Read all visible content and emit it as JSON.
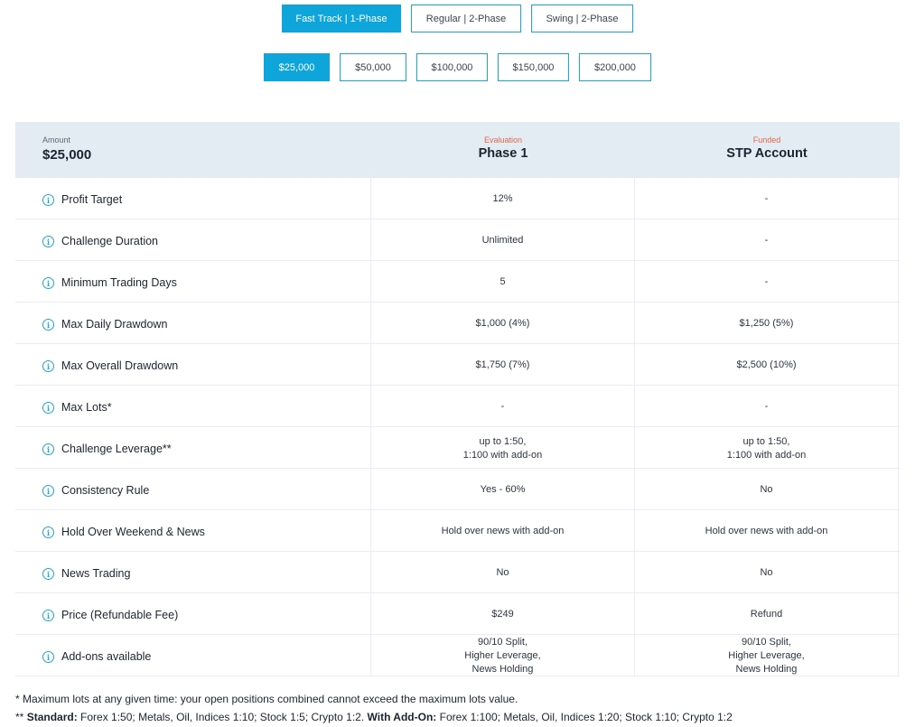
{
  "program_tabs": [
    {
      "label": "Fast Track | 1-Phase",
      "active": true
    },
    {
      "label": "Regular | 2-Phase",
      "active": false
    },
    {
      "label": "Swing | 2-Phase",
      "active": false
    }
  ],
  "amount_tabs": [
    {
      "label": "$25,000",
      "active": true
    },
    {
      "label": "$50,000",
      "active": false
    },
    {
      "label": "$100,000",
      "active": false
    },
    {
      "label": "$150,000",
      "active": false
    },
    {
      "label": "$200,000",
      "active": false
    }
  ],
  "header": {
    "amount_caption": "Amount",
    "amount_value": "$25,000",
    "col1_caption": "Evaluation",
    "col1_title": "Phase 1",
    "col2_caption": "Funded",
    "col2_title": "STP Account"
  },
  "info_icon": "info-circle-icon",
  "rows": [
    {
      "label": "Profit Target",
      "phase1": "12%",
      "stp": "-"
    },
    {
      "label": "Challenge Duration",
      "phase1": "Unlimited",
      "stp": "-"
    },
    {
      "label": "Minimum Trading Days",
      "phase1": "5",
      "stp": "-"
    },
    {
      "label": "Max Daily Drawdown",
      "phase1": "$1,000 (4%)",
      "stp": "$1,250 (5%)"
    },
    {
      "label": "Max Overall Drawdown",
      "phase1": "$1,750 (7%)",
      "stp": "$2,500 (10%)"
    },
    {
      "label": "Max Lots*",
      "phase1": "-",
      "stp": "-"
    },
    {
      "label": "Challenge Leverage**",
      "phase1": "up to 1:50,\n1:100 with add-on",
      "stp": "up to 1:50,\n1:100 with add-on"
    },
    {
      "label": "Consistency Rule",
      "phase1": "Yes - 60%",
      "stp": "No"
    },
    {
      "label": "Hold Over Weekend & News",
      "phase1": "Hold over news with add-on",
      "stp": "Hold over news with add-on"
    },
    {
      "label": "News Trading",
      "phase1": "No",
      "stp": "No"
    },
    {
      "label": "Price (Refundable Fee)",
      "phase1": "$249",
      "stp": "Refund"
    },
    {
      "label": "Add-ons available",
      "phase1": "90/10 Split,\nHigher Leverage,\nNews Holding",
      "stp": "90/10 Split,\nHigher Leverage,\nNews Holding"
    }
  ],
  "notes": {
    "note1": "* Maximum lots at any given time: your open positions combined cannot exceed the maximum lots value.",
    "note2_prefix": "** ",
    "note2_std_label": "Standard:",
    "note2_std_text": " Forex 1:50; Metals, Oil, Indices 1:10; Stock 1:5; Crypto 1:2. ",
    "note2_addon_label": "With Add-On:",
    "note2_addon_text": " Forex 1:100; Metals, Oil, Indices 1:20; Stock 1:10; Crypto 1:2"
  },
  "colors": {
    "accent": "#0ea5db",
    "header_bg": "#e3ebf3",
    "caption_orange": "#e2684a"
  }
}
